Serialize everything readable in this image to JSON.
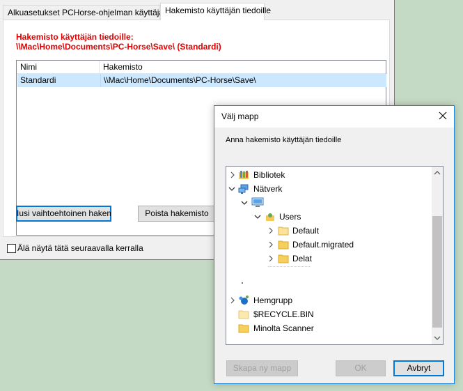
{
  "main": {
    "tabs": [
      {
        "label": "Alkuasetukset PCHorse-ohjelman käyttäjälle"
      },
      {
        "label": "Hakemisto käyttäjän tiedoille"
      }
    ],
    "heading_line1": "Hakemisto käyttäjän tiedoille:",
    "heading_line2": "\\\\Mac\\Home\\Documents\\PC-Horse\\Save\\  (Standardi)",
    "columns": [
      "Nimi",
      "Hakemisto"
    ],
    "rows": [
      {
        "name": "Standardi",
        "path": "\\\\Mac\\Home\\Documents\\PC-Horse\\Save\\"
      }
    ],
    "new_button": "Iusi vaihtoehtoinen hakemist",
    "delete_button": "Poista hakemisto",
    "dont_show_label": "Älä näytä tätä seuraavalla kerralla"
  },
  "dialog": {
    "title": "Välj mapp",
    "prompt": "Anna hakemisto käyttäjän tiedoille",
    "tree": [
      {
        "label": "Bibliotek",
        "icon": "library-icon"
      },
      {
        "label": "Nätverk",
        "icon": "network-icon"
      },
      {
        "label": "",
        "icon": "computer-icon"
      },
      {
        "label": "Users",
        "icon": "shared-folder-icon"
      },
      {
        "label": "Default",
        "icon": "folder-icon"
      },
      {
        "label": "Default.migrated",
        "icon": "folder-icon"
      },
      {
        "label": "Delat",
        "icon": "folder-icon"
      },
      {
        "label": "Hemgrupp",
        "icon": "homegroup-icon"
      },
      {
        "label": "$RECYCLE.BIN",
        "icon": "folder-icon"
      },
      {
        "label": "Minolta Scanner",
        "icon": "folder-icon"
      }
    ],
    "new_folder_button": "Skapa ny mapp",
    "ok_button": "OK",
    "cancel_button": "Avbryt"
  },
  "colors": {
    "heading": "#e00000",
    "selection": "#cce8ff",
    "background": "#c5dac4",
    "accent": "#0078d7"
  }
}
